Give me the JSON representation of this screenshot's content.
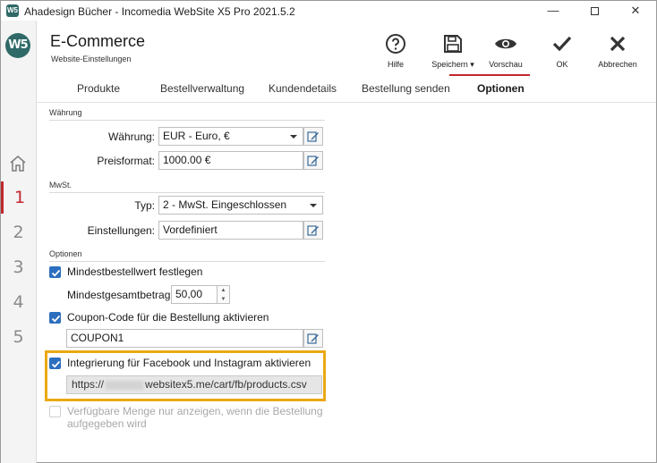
{
  "window": {
    "title": "Ahadesign Bücher - Incomedia WebSite X5 Pro 2021.5.2",
    "app_icon_text": "W5",
    "minimize_glyph": "—",
    "close_glyph": "✕"
  },
  "rail": {
    "logo_text": "W5",
    "steps": [
      "1",
      "2",
      "3",
      "4",
      "5"
    ],
    "active_step": "1"
  },
  "header": {
    "title": "E-Commerce",
    "subtitle": "Website-Einstellungen",
    "tools": {
      "help": "Hilfe",
      "save": "Speichern ▾",
      "preview": "Vorschau",
      "ok": "OK",
      "cancel": "Abbrechen"
    }
  },
  "tabs": [
    "Produkte",
    "Bestellverwaltung",
    "Kundendetails",
    "Bestellung senden",
    "Optionen"
  ],
  "active_tab": "Optionen",
  "currency": {
    "section": "Währung",
    "currency_label": "Währung:",
    "currency_value": "EUR - Euro, €",
    "price_format_label": "Preisformat:",
    "price_format_value": "1000.00 €"
  },
  "vat": {
    "section": "MwSt.",
    "type_label": "Typ:",
    "type_value": "2 - MwSt. Eingeschlossen",
    "settings_label": "Einstellungen:",
    "settings_value": "Vordefiniert"
  },
  "options": {
    "section": "Optionen",
    "min_order_checkbox": "Mindestbestellwert festlegen",
    "min_order_checked": true,
    "min_total_label": "Mindestgesamtbetrag:",
    "min_total_value": "50,00",
    "coupon_checkbox": "Coupon-Code für die Bestellung aktivieren",
    "coupon_checked": true,
    "coupon_value": "COUPON1",
    "fb_checkbox": "Integrierung für Facebook und Instagram aktivieren",
    "fb_checked": true,
    "fb_url_prefix": "https://",
    "fb_url_suffix": "websitex5.me/cart/fb/products.csv",
    "available_qty_line1": "Verfügbare Menge nur anzeigen, wenn die Bestellung",
    "available_qty_line2": "aufgegeben wird",
    "available_qty_checked": false
  },
  "colors": {
    "accent_red": "#c1272d",
    "brand_teal": "#2f6a68",
    "checkbox_blue": "#2c6fbe",
    "highlight_orange": "#eaa913"
  }
}
